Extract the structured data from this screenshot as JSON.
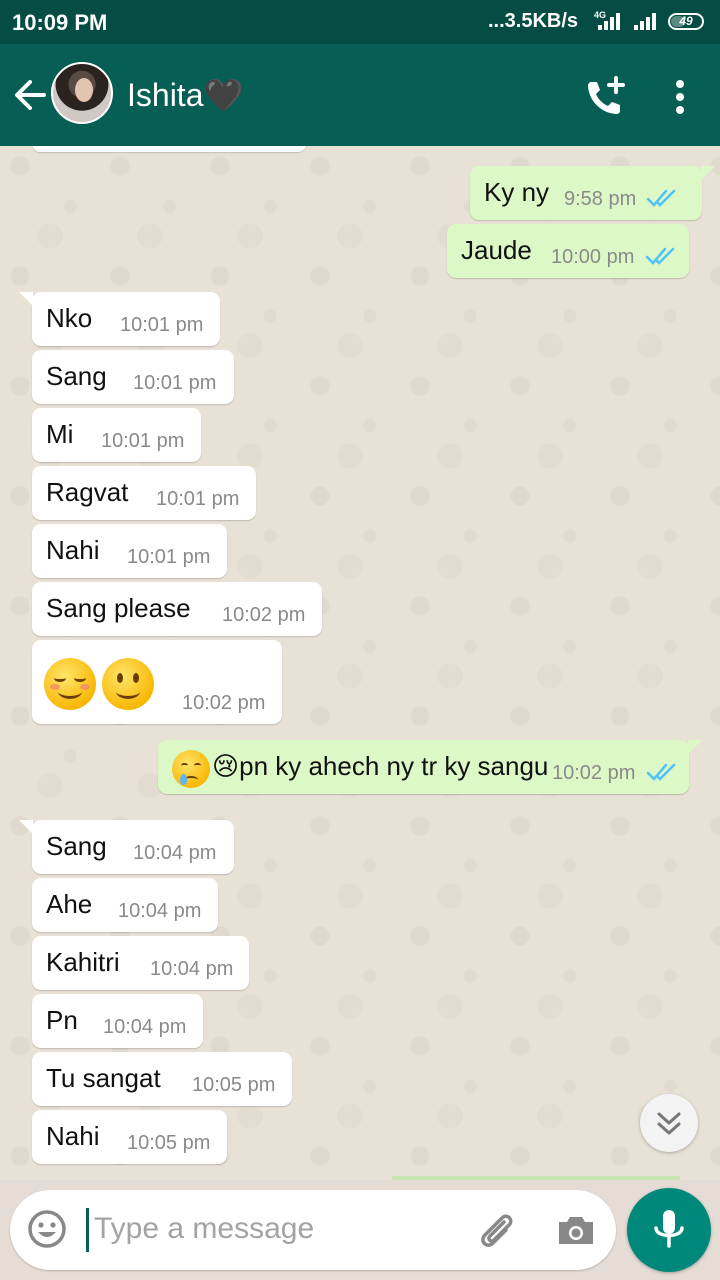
{
  "status_bar": {
    "time": "10:09 PM",
    "network_speed": "...3.5KB/s",
    "network_type": "4G",
    "battery": "49"
  },
  "header": {
    "contact_name": "Ishita🖤",
    "icons": [
      "back-arrow-icon",
      "add-call-icon",
      "more-vert-icon"
    ]
  },
  "messages": [
    {
      "dir": "out",
      "text": "Ky ny",
      "time": "9:58 pm",
      "read": true
    },
    {
      "dir": "out",
      "text": "Jaude",
      "time": "10:00 pm",
      "read": true
    },
    {
      "dir": "in",
      "text": "Nko",
      "time": "10:01 pm"
    },
    {
      "dir": "in",
      "text": "Sang",
      "time": "10:01 pm"
    },
    {
      "dir": "in",
      "text": "Mi",
      "time": "10:01 pm"
    },
    {
      "dir": "in",
      "text": "Ragvat",
      "time": "10:01 pm"
    },
    {
      "dir": "in",
      "text": "Nahi",
      "time": "10:01 pm"
    },
    {
      "dir": "in",
      "text": "Sang please",
      "time": "10:02 pm"
    },
    {
      "dir": "in",
      "text": "☺🙂",
      "time": "10:02 pm"
    },
    {
      "dir": "out",
      "text": "😢pn ky ahech ny tr ky sangu",
      "time": "10:02 pm",
      "read": true
    },
    {
      "dir": "in",
      "text": "Sang",
      "time": "10:04 pm"
    },
    {
      "dir": "in",
      "text": "Ahe",
      "time": "10:04 pm"
    },
    {
      "dir": "in",
      "text": "Kahitri",
      "time": "10:04 pm"
    },
    {
      "dir": "in",
      "text": "Pn",
      "time": "10:04 pm"
    },
    {
      "dir": "in",
      "text": "Tu sangat",
      "time": "10:05 pm"
    },
    {
      "dir": "in",
      "text": "Nahi",
      "time": "10:05 pm"
    }
  ],
  "composer": {
    "placeholder": "Type a message",
    "value": "",
    "icons": [
      "emoji-icon",
      "attach-icon",
      "camera-icon",
      "mic-icon"
    ]
  },
  "colors": {
    "status_bar": "#054d44",
    "app_bar": "#075e54",
    "outgoing_bubble": "#dcf8c6",
    "incoming_bubble": "#ffffff",
    "read_ticks": "#4fc3f7",
    "mic_button": "#00897b"
  }
}
